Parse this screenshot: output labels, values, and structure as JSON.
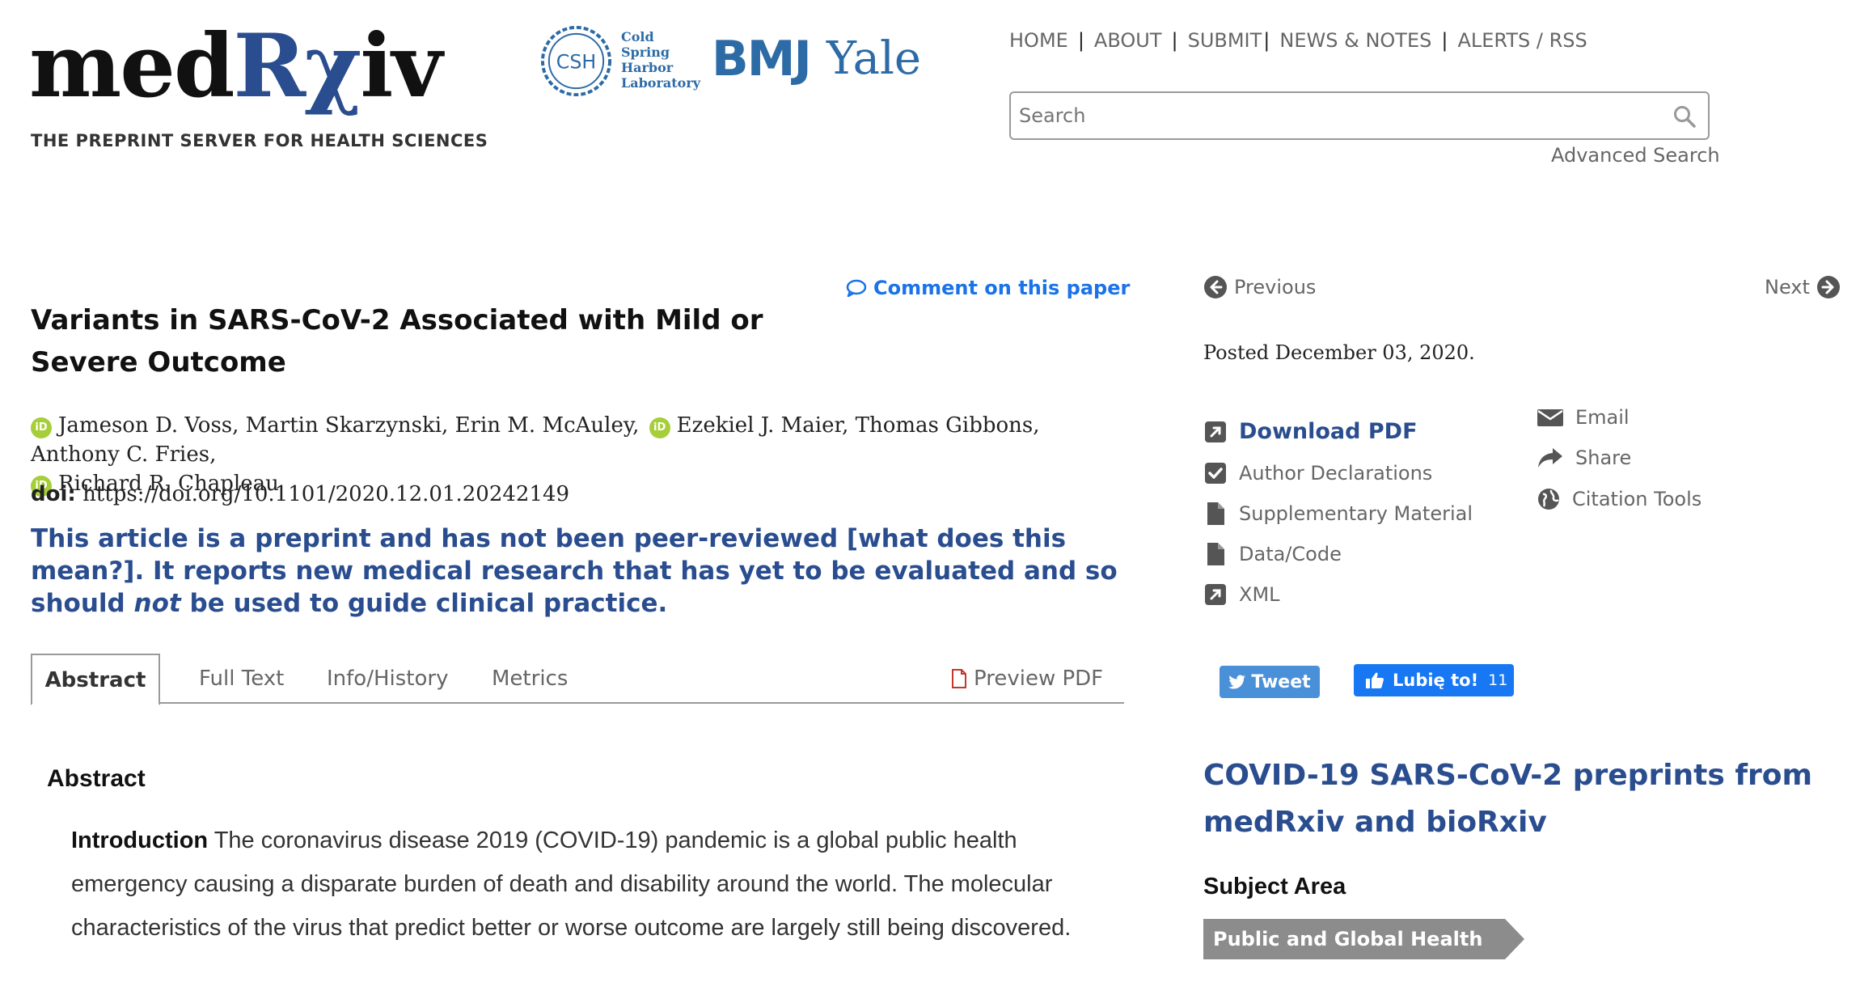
{
  "header": {
    "logo": {
      "part1": "med",
      "part2": "Rχ",
      "part3": "iv",
      "tagline": "THE PREPRINT SERVER FOR HEALTH SCIENCES"
    },
    "partners": {
      "csh_badge": "CSH",
      "csh_lines": [
        "Cold",
        "Spring",
        "Harbor",
        "Laboratory"
      ],
      "bmj": "BMJ",
      "yale": "Yale"
    },
    "nav": [
      "HOME",
      "ABOUT",
      "SUBMIT",
      "NEWS & NOTES",
      "ALERTS / RSS"
    ],
    "search": {
      "placeholder": "Search",
      "value": ""
    },
    "advanced_search": "Advanced Search"
  },
  "article": {
    "comment_link": "Comment on this paper",
    "title": "Variants in SARS-CoV-2 Associated with Mild or Severe Outcome",
    "authors_line1": "Jameson D. Voss, Martin Skarzynski, Erin M. McAuley,",
    "authors_line1b": "Ezekiel J. Maier, Thomas Gibbons, Anthony C. Fries,",
    "authors_line2": "Richard R. Chapleau",
    "orcid_label": "iD",
    "doi_label": "doi:",
    "doi_value": "https://doi.org/10.1101/2020.12.01.20242149",
    "preprint_note_part1": "This article is a preprint and has not been peer-reviewed [what does this mean?]. It reports new medical research that has yet to be evaluated and so should",
    "preprint_note_italic": "not",
    "preprint_note_part2": "be used to guide clinical practice."
  },
  "tabs": [
    "Abstract",
    "Full Text",
    "Info/History",
    "Metrics",
    "Preview PDF"
  ],
  "abstract": {
    "heading": "Abstract",
    "intro_label": "Introduction",
    "intro_text": "The coronavirus disease 2019 (COVID-19) pandemic is a global public health emergency causing a disparate burden of death and disability around the world. The molecular characteristics of the virus that predict better or worse outcome are largely still being discovered."
  },
  "sidebar": {
    "previous": "Previous",
    "next": "Next",
    "posted": "Posted December 03, 2020.",
    "links_left": [
      "Download PDF",
      "Author Declarations",
      "Supplementary Material",
      "Data/Code",
      "XML"
    ],
    "links_right": [
      "Email",
      "Share",
      "Citation Tools"
    ],
    "tweet": "Tweet",
    "like": "Lubię to!",
    "like_count": "11",
    "covid_heading": "COVID-19 SARS-CoV-2 preprints from medRxiv and bioRxiv",
    "subject_area_label": "Subject Area",
    "subject_area": "Public and Global Health"
  },
  "colors": {
    "brand_blue": "#2a4d8f",
    "link_blue": "#1a73e8",
    "orcid_green": "#a6ce39",
    "tweet_blue": "#4a90d9",
    "fb_blue": "#1877f2"
  }
}
